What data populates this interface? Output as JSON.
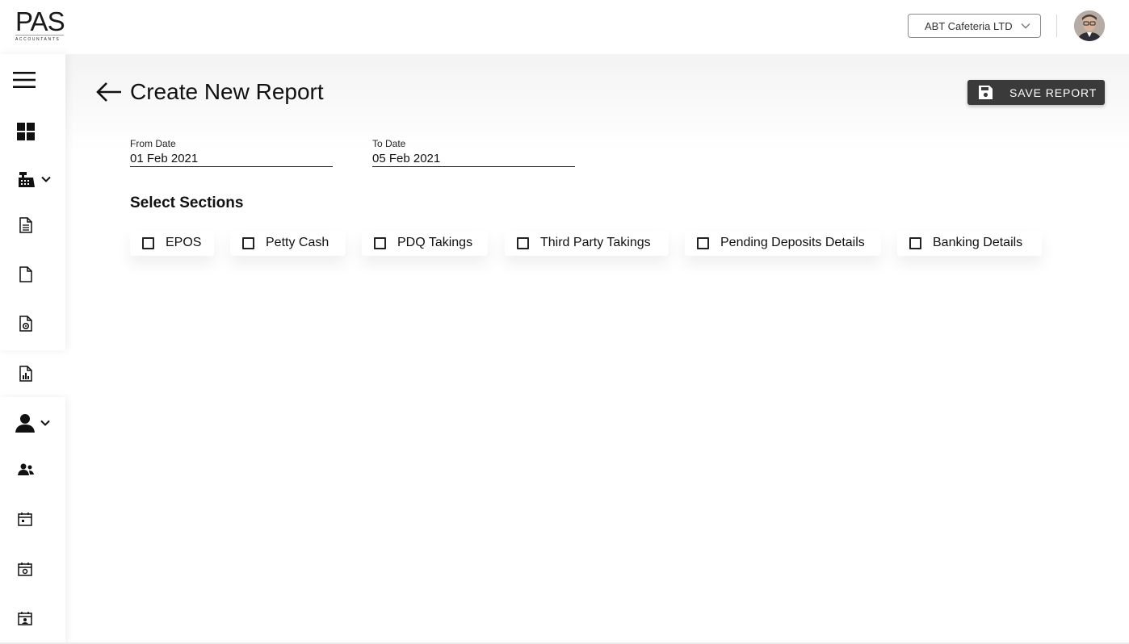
{
  "header": {
    "logo_text": "PAS",
    "logo_subtext": "ACCOUNTANTS",
    "company_selected": "ABT Cafeteria LTD"
  },
  "sidebar": {
    "items": [
      {
        "icon": "menu-icon"
      },
      {
        "icon": "dashboard-icon"
      },
      {
        "icon": "cash-register-icon",
        "expandable": true
      },
      {
        "icon": "document-lines-icon"
      },
      {
        "icon": "document-icon"
      },
      {
        "icon": "document-gear-icon"
      },
      {
        "icon": "report-chart-icon"
      },
      {
        "icon": "user-icon",
        "expandable": true
      },
      {
        "icon": "users-group-icon"
      },
      {
        "icon": "calendar-icon"
      },
      {
        "icon": "calendar-gear-icon"
      },
      {
        "icon": "calendar-person-icon"
      }
    ]
  },
  "page": {
    "title": "Create New Report",
    "save_label": "SAVE REPORT"
  },
  "form": {
    "from_date": {
      "label": "From Date",
      "value": "01 Feb 2021"
    },
    "to_date": {
      "label": "To Date",
      "value": "05 Feb 2021"
    },
    "sections_title": "Select Sections",
    "sections": [
      {
        "label": "EPOS",
        "checked": false
      },
      {
        "label": "Petty Cash",
        "checked": false
      },
      {
        "label": "PDQ Takings",
        "checked": false
      },
      {
        "label": "Third Party Takings",
        "checked": false
      },
      {
        "label": "Pending Deposits Details",
        "checked": false
      },
      {
        "label": "Banking Details",
        "checked": false
      }
    ]
  },
  "colors": {
    "save_button_bg": "#3a3a3a",
    "logo_accent": "#c9a227"
  }
}
